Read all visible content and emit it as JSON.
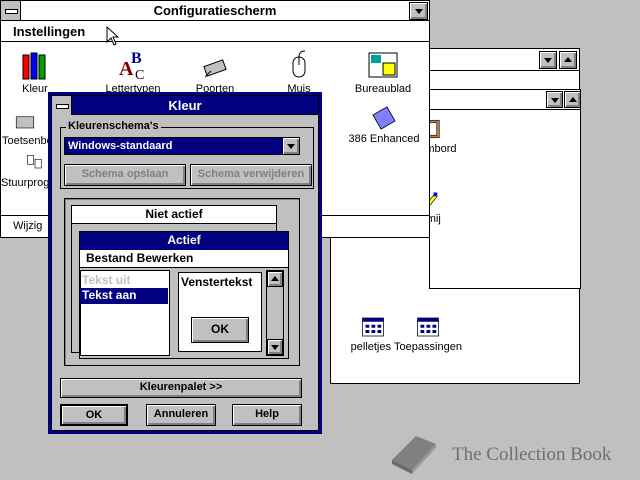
{
  "control_panel": {
    "title": "Configuratiescherm",
    "menu": [
      "Instellingen"
    ],
    "icons": [
      {
        "label": "Kleur"
      },
      {
        "label": "Lettertypen"
      },
      {
        "label": "Poorten"
      },
      {
        "label": "Muis"
      },
      {
        "label": "Bureaublad"
      },
      {
        "label": "Toetsenbord"
      },
      {
        "label": "386 Enhanced"
      },
      {
        "label": "Stuurprogramma's"
      }
    ],
    "status": "Wijzig"
  },
  "program_manager": {
    "icons": [
      {
        "label": "Klembord"
      },
      {
        "label": "smij"
      },
      {
        "label": "Spelletjes"
      },
      {
        "label": "Toepassingen"
      }
    ]
  },
  "color_dialog": {
    "title": "Kleur",
    "scheme_group_label": "Kleurenschema's",
    "scheme_value": "Windows-standaard",
    "save_scheme_label": "Schema opslaan",
    "delete_scheme_label": "Schema verwijderen",
    "preview": {
      "inactive_title": "Niet actief",
      "active_title": "Actief",
      "menu_text": "Bestand  Bewerken",
      "disabled_text": "Tekst uit",
      "highlight_text": "Tekst aan",
      "window_text": "Venstertekst",
      "ok_label": "OK"
    },
    "palette_button": "Kleurenpalet >>",
    "ok_button": "OK",
    "cancel_button": "Annuleren",
    "help_button": "Help"
  },
  "watermark": "The Collection Book",
  "colors": {
    "active_title": "#000080",
    "face": "#c0c0c0",
    "desktop": "#c0c0c0"
  }
}
